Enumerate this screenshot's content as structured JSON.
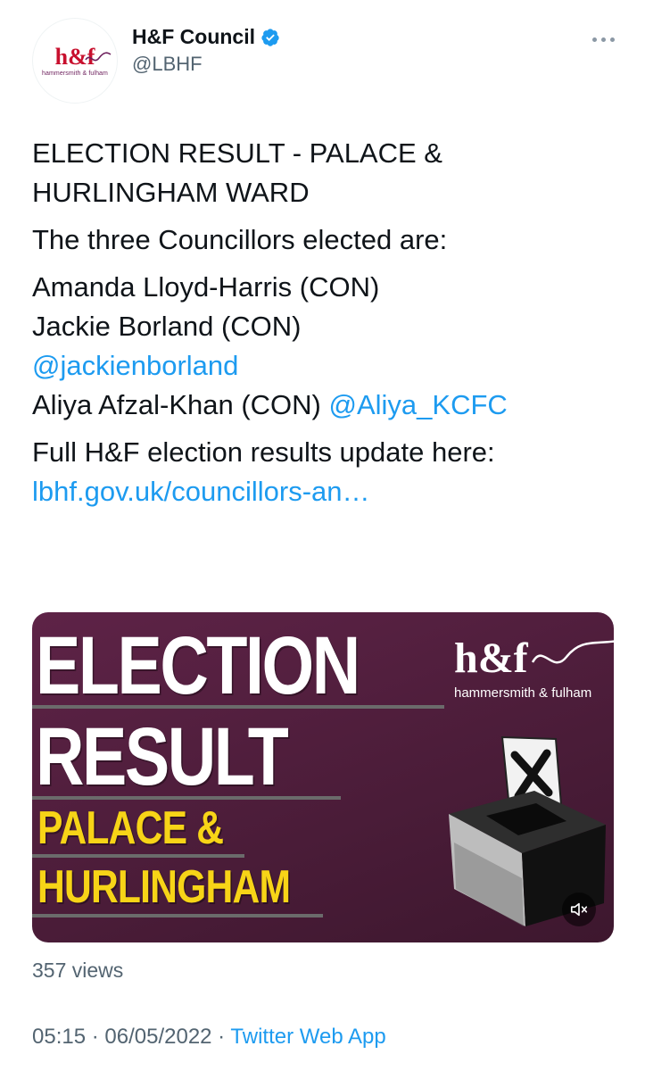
{
  "account": {
    "display_name": "H&F Council",
    "handle": "@LBHF",
    "verified": true,
    "avatar_logo": {
      "main": "h&f",
      "sub": "hammersmith & fulham"
    }
  },
  "tweet": {
    "headline_line1": "ELECTION RESULT - PALACE &",
    "headline_line2": "HURLINGHAM WARD",
    "intro": "The three Councillors elected are:",
    "councillor_1": "Amanda Lloyd-Harris (CON)",
    "councillor_2": "Jackie Borland (CON)",
    "councillor_2_mention": "@jackienborland",
    "councillor_3": "Aliya Afzal-Khan (CON) ",
    "councillor_3_mention": "@Aliya_KCFC",
    "update_text": "Full H&F election results update here:",
    "update_link": "lbhf.gov.uk/councillors-an…"
  },
  "media": {
    "title_line1": "ELECTION",
    "title_line2": "RESULT",
    "ward_line1": "PALACE &",
    "ward_line2": "HURLINGHAM",
    "brand_main": "h&f",
    "brand_sub": "hammersmith & fulham",
    "mute_icon": "speaker-muted-icon",
    "colors": {
      "background": "#4a1c38",
      "ward_text": "#f7d417"
    }
  },
  "stats": {
    "views": "357 views"
  },
  "meta": {
    "time": "05:15",
    "separator": " · ",
    "date": "06/05/2022",
    "source": "Twitter Web App"
  },
  "colors": {
    "link": "#1d9bf0",
    "secondary_text": "#536471",
    "verified_badge": "#1d9bf0"
  }
}
